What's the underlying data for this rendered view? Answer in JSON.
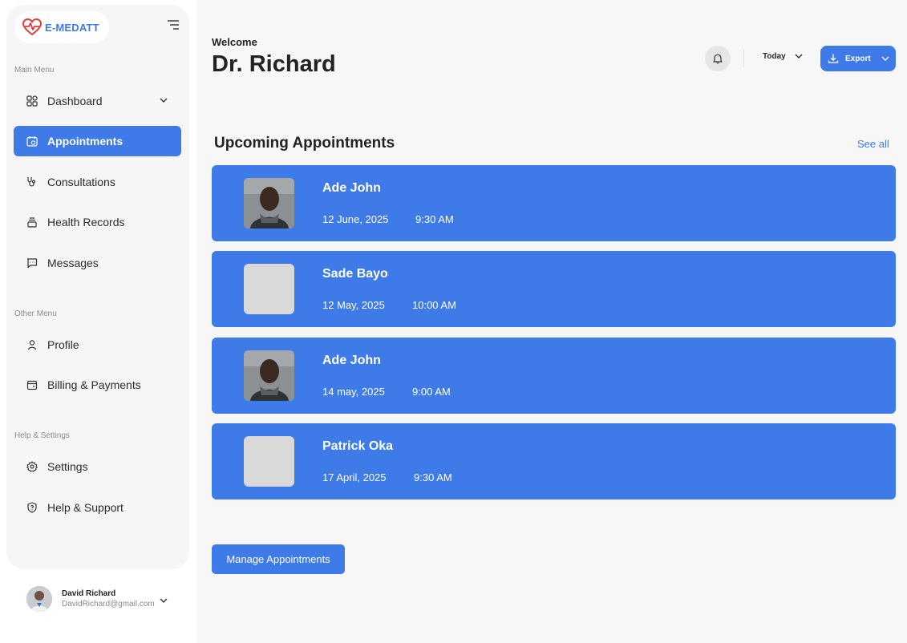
{
  "brand": {
    "name": "E-MEDATT",
    "accent": "#3e7be9"
  },
  "sidebar": {
    "main_menu_label": "Main Menu",
    "other_menu_label": "Other Menu",
    "help_label": "Help & Settings",
    "items": [
      {
        "label": "Dashboard",
        "icon": "grid-icon"
      },
      {
        "label": "Appointments",
        "icon": "calendar-icon",
        "active": true
      },
      {
        "label": "Consultations",
        "icon": "stethoscope-icon"
      },
      {
        "label": "Health Records",
        "icon": "records-icon"
      },
      {
        "label": "Messages",
        "icon": "message-icon"
      },
      {
        "label": "Profile",
        "icon": "user-icon"
      },
      {
        "label": "Billing & Payments",
        "icon": "wallet-icon"
      },
      {
        "label": "Settings",
        "icon": "gear-icon"
      },
      {
        "label": "Help & Support",
        "icon": "shield-help-icon"
      }
    ]
  },
  "user": {
    "name": "David Richard",
    "email": "DavidRichard@gmail.com"
  },
  "header": {
    "welcome": "Welcome",
    "doctor_name": "Dr. Richard",
    "period": "Today",
    "export_label": "Export"
  },
  "appointments": {
    "title": "Upcoming Appointments",
    "see_all": "See all",
    "items": [
      {
        "name": "Ade John",
        "date": "12 June, 2025",
        "time": "9:30 AM",
        "has_photo": true
      },
      {
        "name": "Sade Bayo",
        "date": "12 May, 2025",
        "time": "10:00 AM",
        "has_photo": false
      },
      {
        "name": "Ade John",
        "date": "14 may, 2025",
        "time": "9:00 AM",
        "has_photo": true
      },
      {
        "name": "Patrick Oka",
        "date": "17 April, 2025",
        "time": "9:30 AM",
        "has_photo": false
      }
    ],
    "manage_label": "Manage Appointments"
  }
}
